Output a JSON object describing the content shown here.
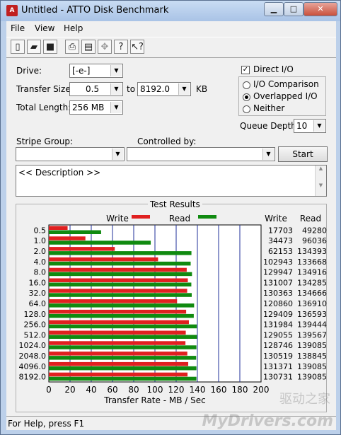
{
  "window": {
    "title": "Untitled - ATTO Disk Benchmark"
  },
  "window_buttons": {
    "minimize": "▁",
    "maximize": "□",
    "close": "✕"
  },
  "menu": [
    "File",
    "View",
    "Help"
  ],
  "toolbar_icons": [
    "new-icon",
    "open-icon",
    "save-icon",
    "print-icon",
    "print-preview-icon",
    "move-icon",
    "help-icon",
    "context-help-icon"
  ],
  "form": {
    "drive_label": "Drive:",
    "drive_value": "[-e-]",
    "transfer_size_label": "Transfer Size:",
    "transfer_from": "0.5",
    "to_label": "to",
    "transfer_to": "8192.0",
    "kb_label": "KB",
    "total_length_label": "Total Length:",
    "total_length_value": "256 MB",
    "direct_io_label": "Direct I/O",
    "direct_io_checked": true,
    "io_comparison_label": "I/O Comparison",
    "overlapped_io_label": "Overlapped I/O",
    "neither_label": "Neither",
    "selected_mode": "Overlapped I/O",
    "queue_depth_label": "Queue Depth:",
    "queue_depth_value": "10",
    "stripe_group_label": "Stripe Group:",
    "stripe_group_value": "",
    "controlled_by_label": "Controlled by:",
    "controlled_by_value": "",
    "start_label": "Start",
    "description_text": "<< Description >>"
  },
  "results": {
    "title": "Test Results",
    "legend_write": "Write",
    "legend_read": "Read",
    "col_write": "Write",
    "col_read": "Read"
  },
  "chart_data": {
    "type": "bar",
    "orientation": "horizontal",
    "categories": [
      "0.5",
      "1.0",
      "2.0",
      "4.0",
      "8.0",
      "16.0",
      "32.0",
      "64.0",
      "128.0",
      "256.0",
      "512.0",
      "1024.0",
      "2048.0",
      "4096.0",
      "8192.0"
    ],
    "series": [
      {
        "name": "Write",
        "color": "#e02020",
        "values": [
          17703,
          34473,
          62153,
          102943,
          129947,
          131007,
          130363,
          120860,
          129409,
          131984,
          129055,
          128746,
          130519,
          131371,
          130731
        ]
      },
      {
        "name": "Read",
        "color": "#108a10",
        "values": [
          49280,
          96036,
          134393,
          133668,
          134916,
          134285,
          134666,
          136910,
          136593,
          139444,
          139567,
          139085,
          138845,
          139085,
          139085
        ]
      }
    ],
    "xlabel": "Transfer Rate - MB / Sec",
    "xticks": [
      "0",
      "20",
      "40",
      "60",
      "80",
      "100",
      "120",
      "140",
      "160",
      "180",
      "200"
    ],
    "xlim": [
      0,
      200
    ],
    "grid": true
  },
  "status": {
    "text": "For Help, press F1"
  },
  "watermark": {
    "text": "MyDrivers.com",
    "cn": "驱动之家"
  }
}
